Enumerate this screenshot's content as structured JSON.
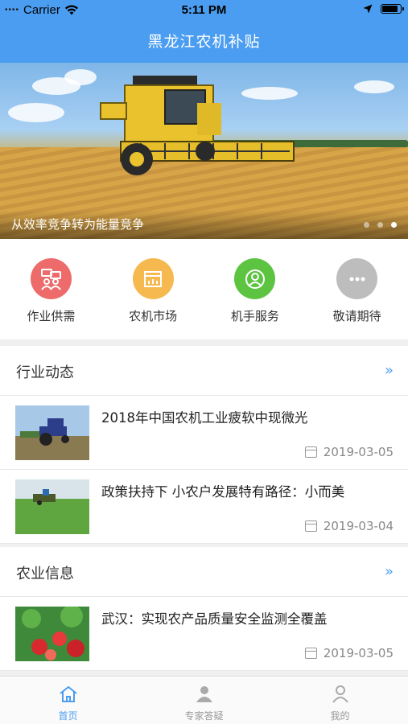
{
  "status_bar": {
    "carrier": "Carrier",
    "time": "5:11 PM"
  },
  "nav": {
    "title": "黑龙江农机补贴"
  },
  "banner": {
    "caption": "从效率竞争转为能量竞争",
    "pages": 3,
    "active_page": 3
  },
  "features": [
    {
      "label": "作业供需",
      "icon": "people-chat-icon",
      "color": "#ee6b6b"
    },
    {
      "label": "农机市场",
      "icon": "market-icon",
      "color": "#f6b94f"
    },
    {
      "label": "机手服务",
      "icon": "person-service-icon",
      "color": "#5cc441"
    },
    {
      "label": "敬请期待",
      "icon": "more-icon",
      "color": "#bdbdbd"
    }
  ],
  "industry": {
    "title": "行业动态",
    "more": "»",
    "items": [
      {
        "title": "2018年中国农机工业疲软中现微光",
        "date": "2019-03-05"
      },
      {
        "title": "政策扶持下 小农户发展特有路径：小而美",
        "date": "2019-03-04"
      }
    ]
  },
  "agri": {
    "title": "农业信息",
    "more": "»",
    "items": [
      {
        "title": "武汉：实现农产品质量安全监测全覆盖",
        "date": "2019-03-05"
      }
    ]
  },
  "tabbar": [
    {
      "label": "首页",
      "icon": "home-icon",
      "active": true
    },
    {
      "label": "专家答疑",
      "icon": "expert-icon",
      "active": false
    },
    {
      "label": "我的",
      "icon": "profile-icon",
      "active": false
    }
  ],
  "colors": {
    "primary": "#4a9df0"
  }
}
